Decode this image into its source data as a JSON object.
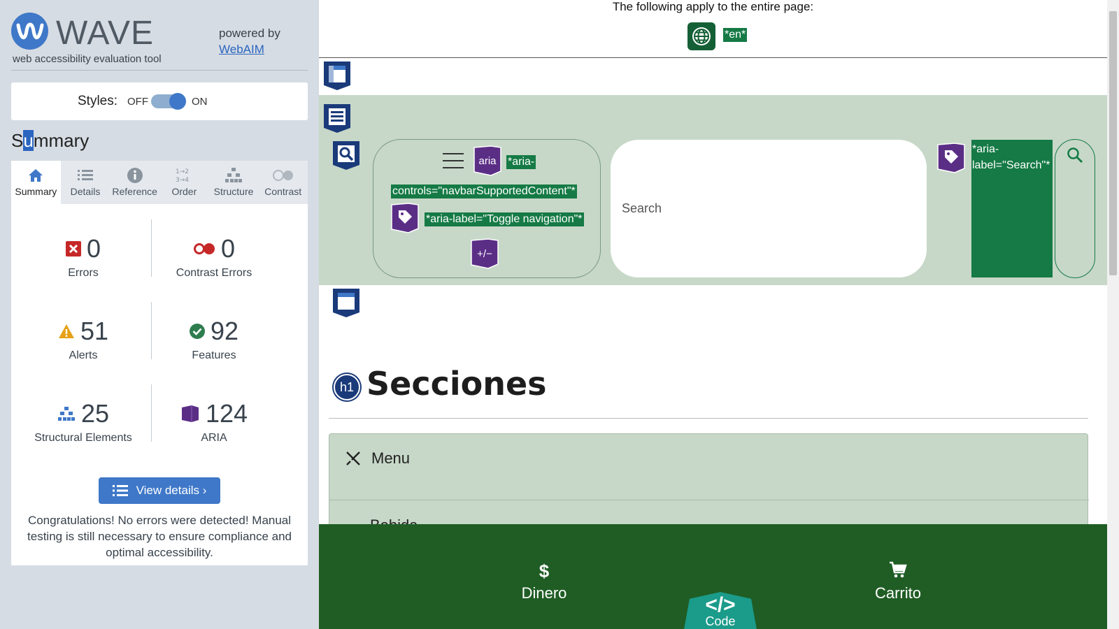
{
  "wave": {
    "logo_text": "WAVE",
    "subtitle": "web accessibility evaluation tool",
    "powered_by": "powered by",
    "webaim_link": "WebAIM",
    "styles_label": "Styles:",
    "styles_off": "OFF",
    "styles_on": "ON",
    "styles_enabled": true,
    "summary_heading_first": "S",
    "summary_heading_cursor": "u",
    "summary_heading_rest": "mmary",
    "tabs": [
      {
        "label": "Summary",
        "icon": "home-icon",
        "active": true
      },
      {
        "label": "Details",
        "icon": "list-icon",
        "active": false
      },
      {
        "label": "Reference",
        "icon": "info-icon",
        "active": false
      },
      {
        "label": "Order",
        "icon": "order-icon",
        "active": false
      },
      {
        "label": "Structure",
        "icon": "structure-icon",
        "active": false
      },
      {
        "label": "Contrast",
        "icon": "contrast-icon",
        "active": false
      }
    ],
    "stats": {
      "errors": {
        "count": "0",
        "label": "Errors",
        "icon": "error-icon",
        "color": "#c62828"
      },
      "contrast_errors": {
        "count": "0",
        "label": "Contrast Errors",
        "icon": "contrast-error-icon",
        "color": "#c62828"
      },
      "alerts": {
        "count": "51",
        "label": "Alerts",
        "icon": "alert-icon",
        "color": "#e6a117"
      },
      "features": {
        "count": "92",
        "label": "Features",
        "icon": "feature-icon",
        "color": "#2e7d4f"
      },
      "structural": {
        "count": "25",
        "label": "Structural Elements",
        "icon": "structure-icon",
        "color": "#3f78c8"
      },
      "aria": {
        "count": "124",
        "label": "ARIA",
        "icon": "aria-icon",
        "color": "#5b2e86"
      }
    },
    "view_details": "View details ›",
    "congrats": "Congratulations! No errors were detected! Manual testing is still necessary to ensure compliance and optimal accessibility."
  },
  "page": {
    "whole_page_note": "The following apply to the entire page:",
    "lang_tag": "*en*",
    "aria_controls_part1": "*aria-",
    "aria_controls_part2": "controls=\"navbarSupportedContent\"*",
    "aria_label_toggle": "*aria-label=\"Toggle navigation\"*",
    "aria_label_search": "*aria-label=\"Search\"*",
    "aria_badge_text": "aria",
    "expand_badge_text": "+/−",
    "search_placeholder": "Search",
    "h1_badge": "h1",
    "heading": "Secciones",
    "accordion_item1": "Menu",
    "accordion_item2": "Bebida",
    "bottom_nav": {
      "money_icon": "$",
      "money_label": "Dinero",
      "code_symbol": "</>",
      "code_label": "Code",
      "cart_label": "Carrito"
    }
  }
}
